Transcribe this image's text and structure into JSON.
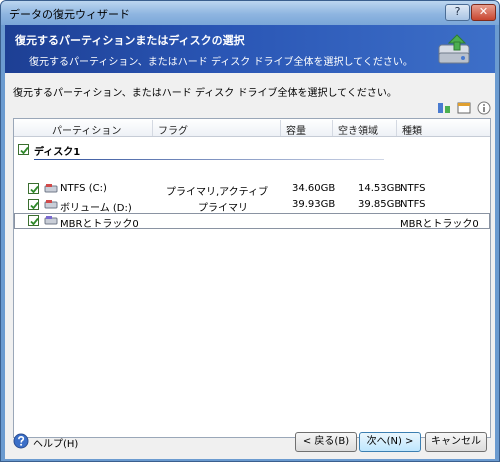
{
  "window": {
    "title": "データの復元ウィザード"
  },
  "header": {
    "title": "復元するパーティションまたはディスクの選択",
    "subtitle": "復元するパーティション、またはハード ディスク ドライブ全体を選択してください。"
  },
  "instruction": "復元するパーティション、またはハード ディスク ドライブ全体を選択してください。",
  "columns": [
    "パーティション",
    "フラグ",
    "容量",
    "空き領域",
    "種類"
  ],
  "disk": {
    "label": "ディスク1",
    "checked": true
  },
  "rows": [
    {
      "name": "NTFS (C:)",
      "flag": "プライマリ,アクティブ",
      "capacity": "34.60GB",
      "free": "14.53GB",
      "type": "NTFS",
      "checked": true
    },
    {
      "name": "ボリューム (D:)",
      "flag": "プライマリ",
      "capacity": "39.93GB",
      "free": "39.85GB",
      "type": "NTFS",
      "checked": true
    },
    {
      "name": "MBRとトラック0",
      "flag": "",
      "capacity": "",
      "free": "",
      "type": "MBRとトラック0",
      "checked": true
    }
  ],
  "footer": {
    "help": "ヘルプ(H)",
    "back": "< 戻る(B)",
    "next": "次へ(N) >",
    "cancel": "キャンセル"
  },
  "icons": {
    "help_titlebar": "question-icon",
    "close": "close-icon",
    "wizard": "disk-restore-icon"
  }
}
